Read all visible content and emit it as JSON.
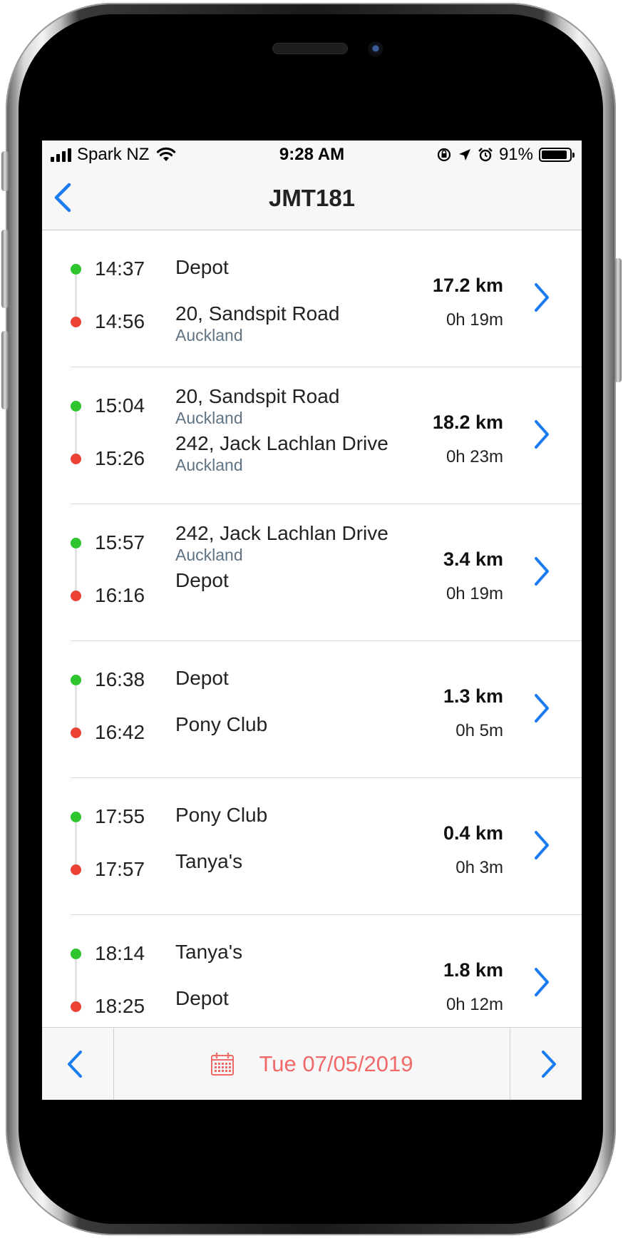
{
  "status_bar": {
    "carrier": "Spark NZ",
    "time": "9:28 AM",
    "battery": "91%",
    "battery_level": 0.91
  },
  "nav": {
    "title": "JMT181",
    "back_icon": "chevron-left-icon"
  },
  "trips": [
    {
      "start_time": "14:37",
      "end_time": "14:56",
      "start_name": "Depot",
      "start_city": "",
      "end_name": "20, Sandspit Road",
      "end_city": "Auckland",
      "distance": "17.2 km",
      "duration": "0h 19m"
    },
    {
      "start_time": "15:04",
      "end_time": "15:26",
      "start_name": "20, Sandspit Road",
      "start_city": "Auckland",
      "end_name": "242, Jack Lachlan Drive",
      "end_city": "Auckland",
      "distance": "18.2 km",
      "duration": "0h 23m"
    },
    {
      "start_time": "15:57",
      "end_time": "16:16",
      "start_name": "242, Jack Lachlan Drive",
      "start_city": "Auckland",
      "end_name": "Depot",
      "end_city": "",
      "distance": "3.4 km",
      "duration": "0h 19m"
    },
    {
      "start_time": "16:38",
      "end_time": "16:42",
      "start_name": "Depot",
      "start_city": "",
      "end_name": "Pony Club",
      "end_city": "",
      "distance": "1.3 km",
      "duration": "0h 5m"
    },
    {
      "start_time": "17:55",
      "end_time": "17:57",
      "start_name": "Pony Club",
      "start_city": "",
      "end_name": "Tanya's",
      "end_city": "",
      "distance": "0.4 km",
      "duration": "0h 3m"
    },
    {
      "start_time": "18:14",
      "end_time": "18:25",
      "start_name": "Tanya's",
      "start_city": "",
      "end_name": "Depot",
      "end_city": "",
      "distance": "1.8 km",
      "duration": "0h 12m"
    }
  ],
  "footer": {
    "date_label": "Tue 07/05/2019",
    "prev_icon": "chevron-left-icon",
    "next_icon": "chevron-right-icon",
    "calendar_icon": "calendar-icon"
  },
  "colors": {
    "accent": "#1a7cf0",
    "start_dot": "#2ec52e",
    "end_dot": "#ea4335",
    "date_text": "#f06a6a",
    "city_text": "#5f7384"
  }
}
